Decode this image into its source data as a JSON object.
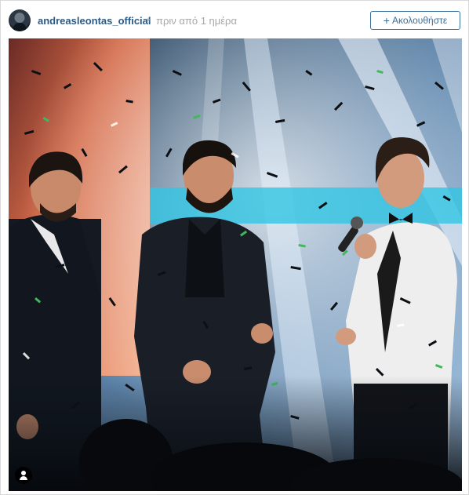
{
  "post": {
    "username": "andreasleontas_official",
    "separator": "•",
    "time_ago": "πριν από 1 ημέρα",
    "follow_label": "Ακολουθήστε",
    "follow_plus": "+"
  },
  "photo": {
    "description_icon": "user-tag-icon",
    "stage_colors": {
      "warm_left": "#e08a66",
      "cool_right": "#cfe2f1",
      "cyan_band": "#32c6e3"
    }
  }
}
